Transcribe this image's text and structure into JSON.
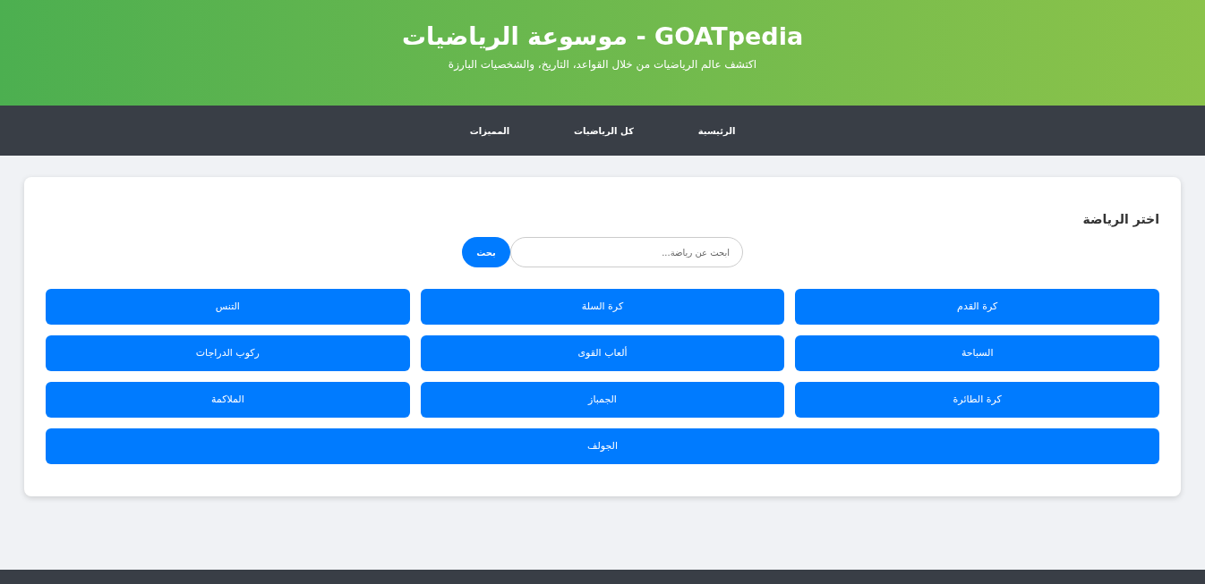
{
  "header": {
    "title": "GOATpedia - موسوعة الرياضيات",
    "subtitle": "اكتشف عالم الرياضيات من خلال القواعد، التاريخ، والشخصيات البارزة"
  },
  "nav": {
    "items": [
      {
        "label": "الرئيسية"
      },
      {
        "label": "كل الرياضيات"
      },
      {
        "label": "المميزات"
      }
    ]
  },
  "sport_picker": {
    "heading": "اختر الرياضة",
    "search": {
      "placeholder": "ابحث عن رياضة...",
      "button": "بحث"
    },
    "sports": [
      {
        "label": "كرة القدم"
      },
      {
        "label": "كرة السلة"
      },
      {
        "label": "التنس"
      },
      {
        "label": "السباحة"
      },
      {
        "label": "ألعاب القوى"
      },
      {
        "label": "ركوب الدراجات"
      },
      {
        "label": "كرة الطائرة"
      },
      {
        "label": "الجمباز"
      },
      {
        "label": "الملاكمة"
      },
      {
        "label": "الجولف"
      }
    ]
  }
}
